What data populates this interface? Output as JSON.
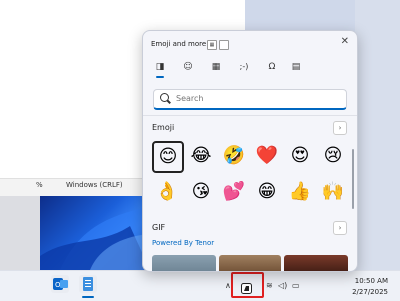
{
  "statusbar": {
    "left_text": "%",
    "encoding": "Windows (CRLF)"
  },
  "panel": {
    "title": "Emoji and more",
    "close_glyph": "✕",
    "tabs": [
      {
        "icon": "emoji-tab-icon",
        "glyph": "◨"
      },
      {
        "icon": "smiley-tab-icon",
        "glyph": "☺"
      },
      {
        "icon": "gif-tab-icon",
        "glyph": "▦"
      },
      {
        "icon": "kaomoji-tab-icon",
        "glyph": ";-)"
      },
      {
        "icon": "symbols-tab-icon",
        "glyph": "Ω"
      },
      {
        "icon": "clipboard-tab-icon",
        "glyph": "▤"
      }
    ],
    "search": {
      "placeholder": "Search"
    },
    "emoji_section": {
      "label": "Emoji",
      "more": "›"
    },
    "emojis": [
      "😊",
      "😂",
      "🤣",
      "❤️",
      "😍",
      "😢",
      "👌",
      "😘",
      "💕",
      "😁",
      "👍",
      "🙌"
    ],
    "gif_section": {
      "label": "GIF",
      "more": "›",
      "powered": "Powered By Tenor"
    }
  },
  "clock": {
    "time": "10:50 AM",
    "date": "2/27/2025"
  }
}
